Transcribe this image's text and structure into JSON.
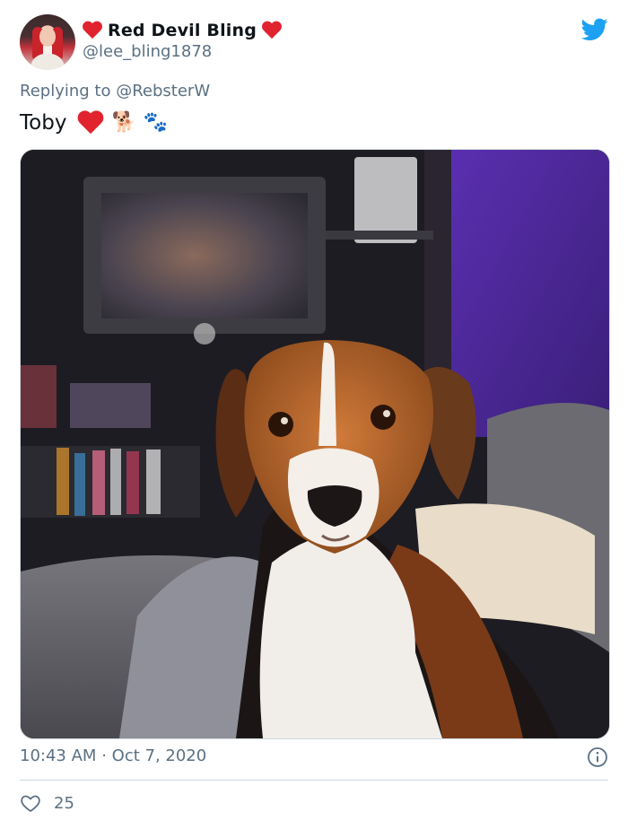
{
  "author": {
    "display_name": "Red Devil Bling",
    "handle": "@lee_bling1878"
  },
  "reply": {
    "prefix": "Replying to",
    "mention": "@RebsterW"
  },
  "tweet": {
    "text": "Toby",
    "emoji_dog": "🐕",
    "emoji_paws": "🐾"
  },
  "meta": {
    "time": "10:43 AM",
    "separator": "·",
    "date": "Oct 7, 2020"
  },
  "stats": {
    "likes": "25"
  },
  "icons": {
    "heart": "heart-icon",
    "twitter": "twitter-bird-icon",
    "info": "info-icon",
    "like": "like-heart-outline-icon"
  },
  "colors": {
    "twitter_blue": "#1da1f2",
    "heart_red": "#e0232e",
    "secondary_text": "#5b7083"
  }
}
